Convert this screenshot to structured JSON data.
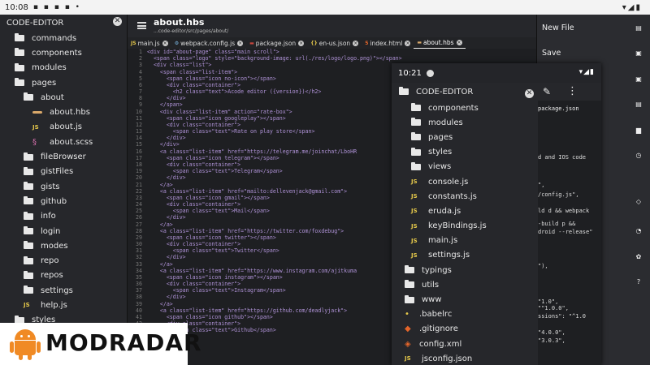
{
  "status_bar": {
    "time": "10:08",
    "icons": "▪ ▪ ▪ ▪ •",
    "right_icons": "▾◢▮"
  },
  "sidebar": {
    "title": "CODE-EDITOR",
    "close_glyph": "✕",
    "items": [
      {
        "label": "commands",
        "type": "folder",
        "indent": 0
      },
      {
        "label": "components",
        "type": "folder",
        "indent": 0
      },
      {
        "label": "modules",
        "type": "folder",
        "indent": 0
      },
      {
        "label": "pages",
        "type": "folder",
        "indent": 0
      },
      {
        "label": "about",
        "type": "folder",
        "indent": 1
      },
      {
        "label": "about.hbs",
        "type": "hbs",
        "indent": 2
      },
      {
        "label": "about.js",
        "type": "js",
        "indent": 2
      },
      {
        "label": "about.scss",
        "type": "scss",
        "indent": 2
      },
      {
        "label": "fileBrowser",
        "type": "folder",
        "indent": 1
      },
      {
        "label": "gistFiles",
        "type": "folder",
        "indent": 1
      },
      {
        "label": "gists",
        "type": "folder",
        "indent": 1
      },
      {
        "label": "github",
        "type": "folder",
        "indent": 1
      },
      {
        "label": "info",
        "type": "folder",
        "indent": 1
      },
      {
        "label": "login",
        "type": "folder",
        "indent": 1
      },
      {
        "label": "modes",
        "type": "folder",
        "indent": 1
      },
      {
        "label": "repo",
        "type": "folder",
        "indent": 1
      },
      {
        "label": "repos",
        "type": "folder",
        "indent": 1
      },
      {
        "label": "settings",
        "type": "folder",
        "indent": 1
      },
      {
        "label": "help.js",
        "type": "js",
        "indent": 1
      },
      {
        "label": "styles",
        "type": "folder",
        "indent": 0
      }
    ]
  },
  "editor": {
    "title": "about.hbs",
    "path": "...code-editor/src/pages/about/",
    "tabs": [
      {
        "icon": "JS",
        "label": "main.js",
        "icon_color": "#e5c84a",
        "active": false
      },
      {
        "icon": "⚙",
        "label": "webpack.config.js",
        "icon_color": "#7cb8e4",
        "active": false
      },
      {
        "icon": "▬",
        "label": "package.json",
        "icon_color": "#c9463d",
        "active": false
      },
      {
        "icon": "{}",
        "label": "en-us.json",
        "icon_color": "#e5c84a",
        "active": false
      },
      {
        "icon": "5",
        "label": "index.html",
        "icon_color": "#e4652a",
        "active": false
      },
      {
        "icon": "▬",
        "label": "about.hbs",
        "icon_color": "#d9a86a",
        "active": true
      }
    ],
    "code_lines": [
      {
        "n": "1",
        "t": "<div id=\"about-page\" class=\"main scroll\">"
      },
      {
        "n": "2",
        "t": "  <span class=\"logo\" style=\"background-image: url(./res/logo/logo.png)\"></span>"
      },
      {
        "n": "3",
        "t": "  <div class=\"list\">"
      },
      {
        "n": "4",
        "t": "    <span class=\"list-item\">"
      },
      {
        "n": "5",
        "t": "      <span class=\"icon no-icon\"></span>"
      },
      {
        "n": "6",
        "t": "      <div class=\"container\">"
      },
      {
        "n": "7",
        "t": "        <h2 class=\"text\">Acode editor ({version})</h2>"
      },
      {
        "n": "8",
        "t": "      </div>"
      },
      {
        "n": "9",
        "t": "    </span>"
      },
      {
        "n": "10",
        "t": "    <div class=\"list-item\" action=\"rate-box\">"
      },
      {
        "n": "11",
        "t": "      <span class=\"icon googleplay\"></span>"
      },
      {
        "n": "12",
        "t": "      <div class=\"container\">"
      },
      {
        "n": "13",
        "t": "        <span class=\"text\">Rate on play store</span>"
      },
      {
        "n": "14",
        "t": "      </div>"
      },
      {
        "n": "15",
        "t": "    </div>"
      },
      {
        "n": "16",
        "t": "    <a class=\"list-item\" href=\"https://telegram.me/joinchat/LboHR"
      },
      {
        "n": "17",
        "t": "      <span class=\"icon telegram\"></span>"
      },
      {
        "n": "18",
        "t": "      <div class=\"container\">"
      },
      {
        "n": "19",
        "t": "        <span class=\"text\">Telegram</span>"
      },
      {
        "n": "20",
        "t": "      </div>"
      },
      {
        "n": "21",
        "t": "    </a>"
      },
      {
        "n": "22",
        "t": "    <a class=\"list-item\" href=\"mailto:dellevenjack@gmail.com\">"
      },
      {
        "n": "23",
        "t": "      <span class=\"icon gmail\"></span>"
      },
      {
        "n": "24",
        "t": "      <div class=\"container\">"
      },
      {
        "n": "25",
        "t": "        <span class=\"text\">Mail</span>"
      },
      {
        "n": "26",
        "t": "      </div>"
      },
      {
        "n": "27",
        "t": "    </a>"
      },
      {
        "n": "28",
        "t": "    <a class=\"list-item\" href=\"https://twitter.com/foxdebug\">"
      },
      {
        "n": "29",
        "t": "      <span class=\"icon twitter\"></span>"
      },
      {
        "n": "30",
        "t": "      <div class=\"container\">"
      },
      {
        "n": "31",
        "t": "        <span class=\"text\">Twitter</span>"
      },
      {
        "n": "32",
        "t": "      </div>"
      },
      {
        "n": "33",
        "t": "    </a>"
      },
      {
        "n": "34",
        "t": "    <a class=\"list-item\" href=\"https://www.instagram.com/ajitkuma"
      },
      {
        "n": "35",
        "t": "      <span class=\"icon instagram\"></span>"
      },
      {
        "n": "36",
        "t": "      <div class=\"container\">"
      },
      {
        "n": "37",
        "t": "        <span class=\"text\">Instagram</span>"
      },
      {
        "n": "38",
        "t": "      </div>"
      },
      {
        "n": "39",
        "t": "    </a>"
      },
      {
        "n": "40",
        "t": "    <a class=\"list-item\" href=\"https://github.com/deadlyjack\">"
      },
      {
        "n": "41",
        "t": "      <span class=\"icon github\"></span>"
      },
      {
        "n": "42",
        "t": "      <div class=\"container\">"
      },
      {
        "n": "43",
        "t": "        <span class=\"text\">Github</span>"
      },
      {
        "n": "44",
        "t": "      </div>"
      },
      {
        "n": "45",
        "t": "    </a>"
      },
      {
        "n": "46",
        "t": "  </div>"
      },
      {
        "n": "47",
        "t": "</div>"
      }
    ]
  },
  "context_menu": {
    "new_file": "New File",
    "save": "Save",
    "icons": [
      "▤",
      "▣",
      "▣",
      "▤",
      "▆",
      "◷",
      "◇",
      "◔",
      "✿",
      "?"
    ]
  },
  "overlay": {
    "time": "10:21",
    "right_icons": "▾◢▮",
    "title": "CODE-EDITOR",
    "close_glyph": "✕",
    "pen_glyph": "✎",
    "dots_glyph": "⋮",
    "tab_label": "package.json",
    "items": [
      {
        "label": "components",
        "type": "folder",
        "indent": 1
      },
      {
        "label": "modules",
        "type": "folder",
        "indent": 1
      },
      {
        "label": "pages",
        "type": "folder",
        "indent": 1
      },
      {
        "label": "styles",
        "type": "folder",
        "indent": 1
      },
      {
        "label": "views",
        "type": "folder",
        "indent": 1
      },
      {
        "label": "console.js",
        "type": "js",
        "indent": 1
      },
      {
        "label": "constants.js",
        "type": "js",
        "indent": 1
      },
      {
        "label": "eruda.js",
        "type": "js",
        "indent": 1
      },
      {
        "label": "keyBindings.js",
        "type": "js",
        "indent": 1
      },
      {
        "label": "main.js",
        "type": "js",
        "indent": 1
      },
      {
        "label": "settings.js",
        "type": "js",
        "indent": 1
      },
      {
        "label": "typings",
        "type": "folder",
        "indent": 0
      },
      {
        "label": "utils",
        "type": "folder",
        "indent": 0
      },
      {
        "label": "www",
        "type": "folder",
        "indent": 0
      },
      {
        "label": ".babelrc",
        "type": "babel",
        "indent": 0
      },
      {
        "label": ".gitignore",
        "type": "git",
        "indent": 0
      },
      {
        "label": "config.xml",
        "type": "xml",
        "indent": 0
      },
      {
        "label": "jsconfig.json",
        "type": "js",
        "indent": 0
      }
    ],
    "code_snippets": [
      "d and IOS code",
      "\",",
      "/config.js\",",
      "ld d && webpack",
      "-build p &&",
      "droid --release\"",
      "\"),",
      "\"1.0\",",
      "\"\"1.0.0\",",
      "ssions\": \"^1.0",
      "\"4.0.0\",",
      "\"3.0.3\","
    ]
  },
  "watermark": {
    "text": "MODRADAR"
  }
}
